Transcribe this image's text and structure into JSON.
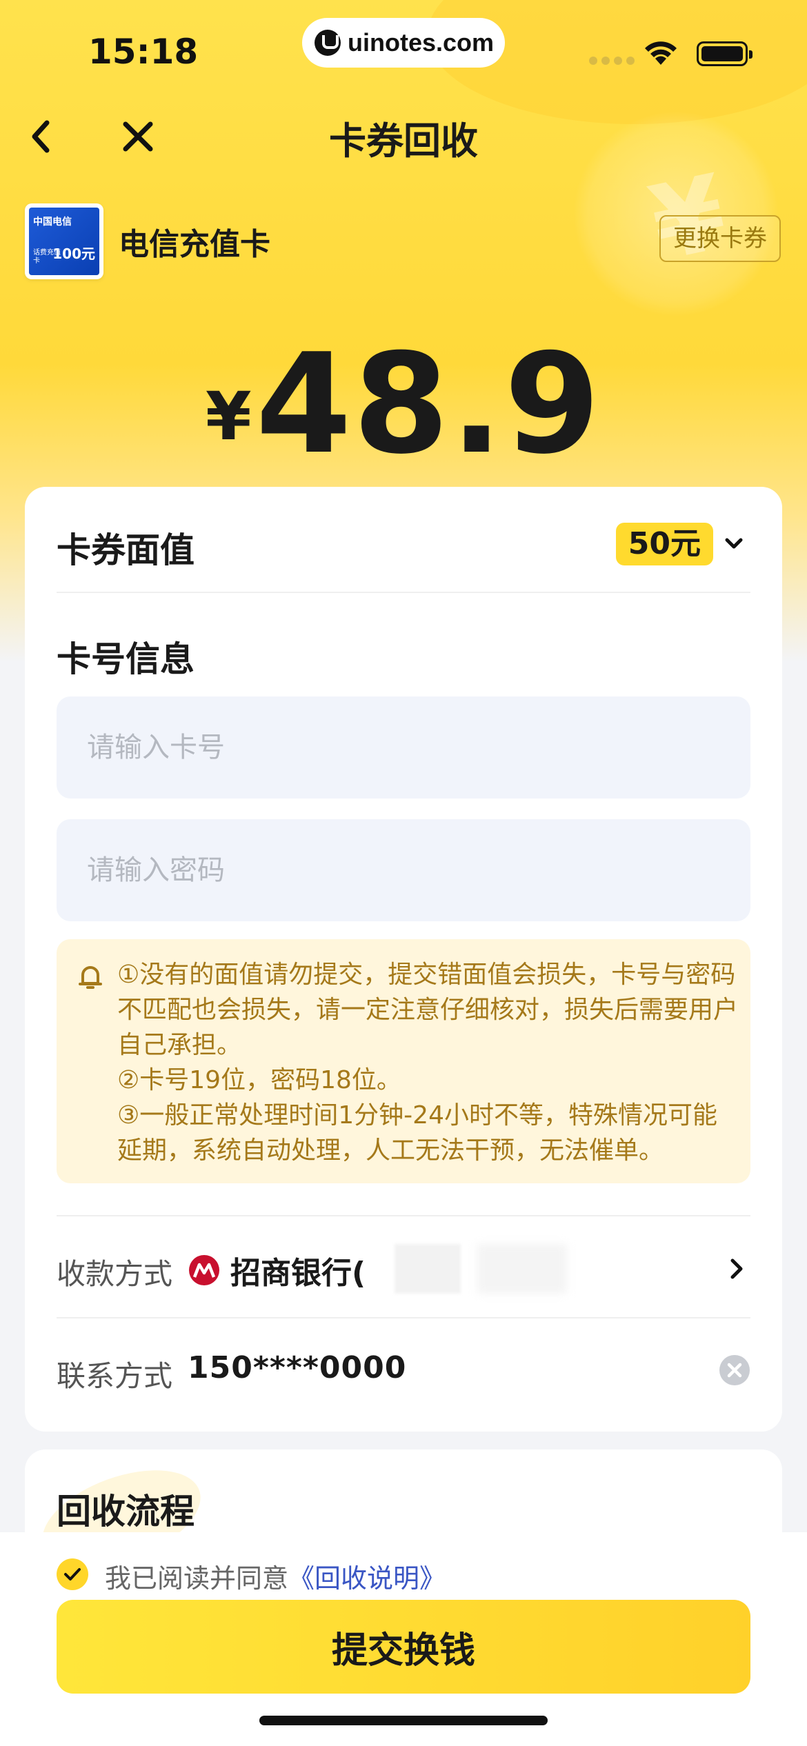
{
  "status_bar": {
    "time": "15:18",
    "url": "uinotes.com"
  },
  "nav": {
    "title": "卡券回收"
  },
  "card": {
    "name": "电信充值卡",
    "change_label": "更换卡券",
    "thumb": {
      "brand": "中国电信",
      "small": "话费充值卡",
      "amount": "100元"
    }
  },
  "price": {
    "symbol": "¥",
    "amount": "48.9"
  },
  "form": {
    "face_value_label": "卡券面值",
    "face_value": "50元",
    "card_info_title": "卡号信息",
    "card_number_placeholder": "请输入卡号",
    "password_placeholder": "请输入密码",
    "notice_lines": [
      "①没有的面值请勿提交，提交错面值会损失，卡号与密码不匹配也会损失，请一定注意仔细核对，损失后需要用户自己承担。",
      "②卡号19位，密码18位。",
      "③一般正常处理时间1分钟-24小时不等，特殊情况可能延期，系统自动处理，人工无法干预，无法催单。"
    ],
    "payee_label": "收款方式",
    "bank_name": "招商银行(",
    "bank_close": ")",
    "contact_label": "联系方式",
    "contact_value": "150****0000"
  },
  "process": {
    "title": "回收流程"
  },
  "bottom": {
    "agree_prefix": "我已阅读并同意",
    "agree_link": "《回收说明》",
    "submit_label": "提交换钱"
  },
  "colors": {
    "brand_yellow": "#FFD62A",
    "notice_bg": "#FFF6DC",
    "notice_text": "#A5791A",
    "link": "#3A56C4",
    "input_bg": "#F1F4FB"
  },
  "icons": {
    "back": "chevron-left-icon",
    "close": "close-icon",
    "face_dropdown": "chevron-down-icon",
    "notice": "bell-icon",
    "bank": "cmb-bank-logo-icon",
    "row_arrow": "chevron-right-icon",
    "clear": "clear-icon",
    "agree": "check-icon"
  }
}
